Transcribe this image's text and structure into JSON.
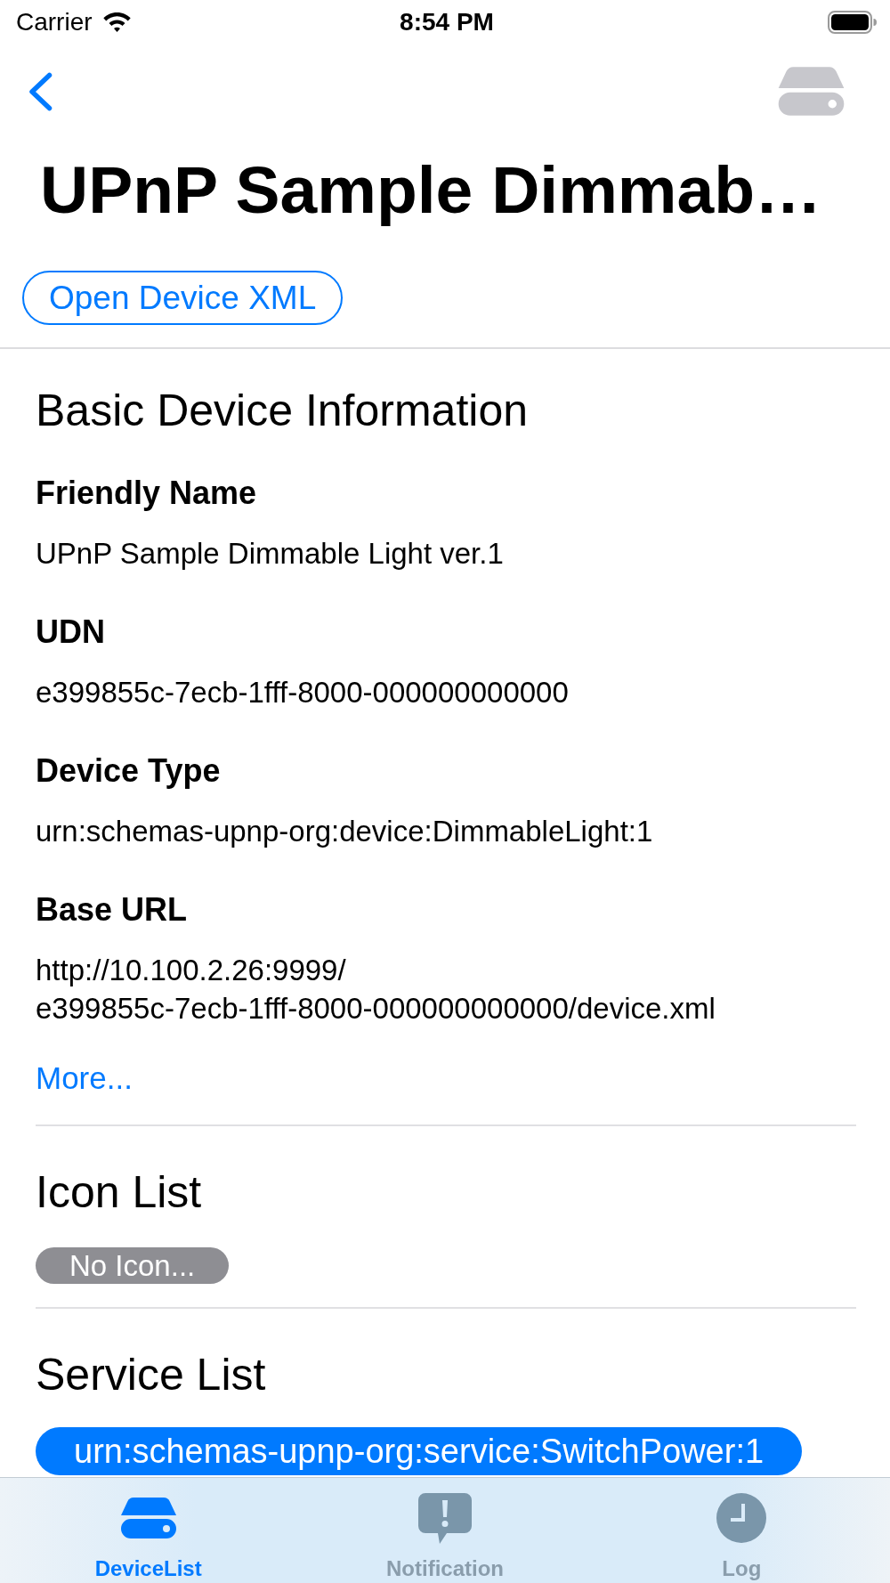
{
  "status_bar": {
    "carrier": "Carrier",
    "time": "8:54 PM"
  },
  "nav_bar": {
    "title": "UPnP Sample Dimmab…",
    "action_button": "Open Device XML"
  },
  "basic_info": {
    "heading": "Basic Device Information",
    "fields": [
      {
        "label": "Friendly Name",
        "value": "UPnP Sample Dimmable Light ver.1"
      },
      {
        "label": "UDN",
        "value": "e399855c-7ecb-1fff-8000-000000000000"
      },
      {
        "label": "Device Type",
        "value": "urn:schemas-upnp-org:device:DimmableLight:1"
      },
      {
        "label": "Base URL",
        "value_lines": [
          "http://10.100.2.26:9999/",
          "e399855c-7ecb-1fff-8000-000000000000/device.xml"
        ]
      }
    ],
    "more_link": "More..."
  },
  "icon_list": {
    "heading": "Icon List",
    "items": [
      {
        "label": "No Icon...",
        "disabled": true
      }
    ]
  },
  "service_list": {
    "heading": "Service List",
    "items": [
      {
        "label": "urn:schemas-upnp-org:service:SwitchPower:1",
        "disabled": false
      }
    ]
  },
  "tab_bar": {
    "tabs": [
      {
        "label": "DeviceList",
        "selected": true
      },
      {
        "label": "Notification",
        "selected": false
      },
      {
        "label": "Log",
        "selected": false
      }
    ]
  }
}
